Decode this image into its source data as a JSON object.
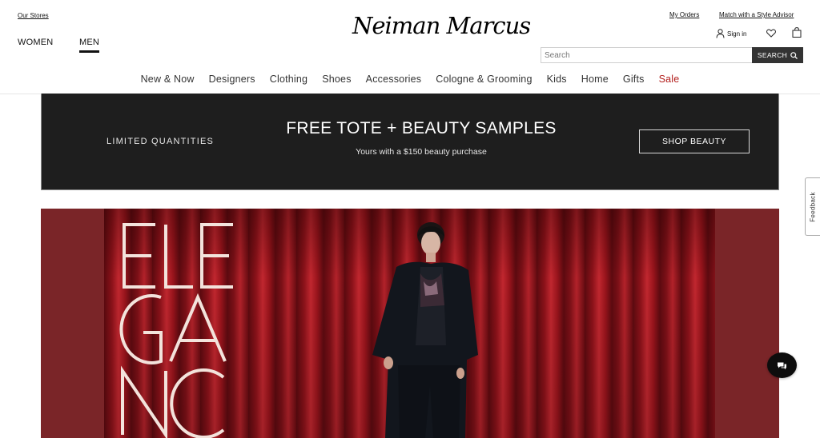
{
  "header": {
    "our_stores": "Our Stores",
    "women": "WOMEN",
    "men": "MEN",
    "logo": "Neiman Marcus",
    "my_orders": "My Orders",
    "style_advisor": "Match with a Style Advisor",
    "sign_in": "Sign in",
    "search_placeholder": "Search",
    "search_button": "SEARCH"
  },
  "nav": {
    "items": [
      "New & Now",
      "Designers",
      "Clothing",
      "Shoes",
      "Accessories",
      "Cologne & Grooming",
      "Kids",
      "Home",
      "Gifts",
      "Sale"
    ]
  },
  "promo": {
    "left": "LIMITED QUANTITIES",
    "title": "FREE TOTE + BEAUTY SAMPLES",
    "subtitle": "Yours with a $150 beauty purchase",
    "cta": "SHOP BEAUTY"
  },
  "hero": {
    "wordmark": "ELEGANCE"
  },
  "feedback": "Feedback",
  "icons": {
    "user": "user-icon",
    "heart": "heart-icon",
    "bag": "shopping-bag-icon",
    "search": "search-icon",
    "chat": "chat-icon"
  },
  "colors": {
    "sale": "#b4211f",
    "promo_bg": "#1e1e1e",
    "hero_bg": "#7a2528",
    "search_button": "#333333"
  }
}
